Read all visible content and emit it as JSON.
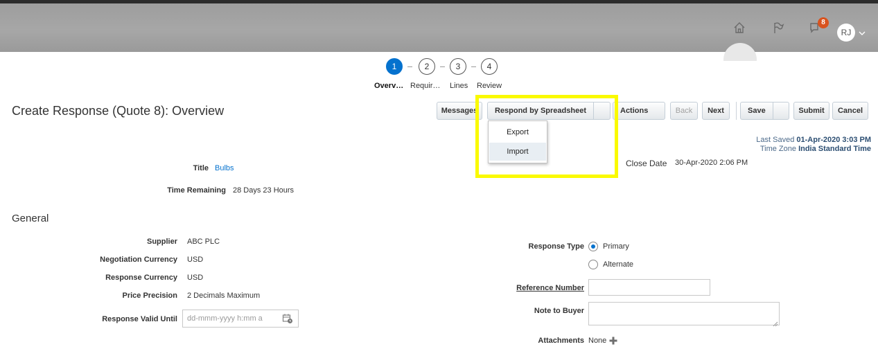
{
  "header": {
    "icons": [
      "home-icon",
      "flag-icon",
      "notifications-icon"
    ],
    "notification_count": "8",
    "user_initials": "RJ"
  },
  "train": {
    "steps": [
      {
        "number": "1",
        "label": "Overv…"
      },
      {
        "number": "2",
        "label": "Requir…"
      },
      {
        "number": "3",
        "label": "Lines"
      },
      {
        "number": "4",
        "label": "Review"
      }
    ],
    "active_step": 1
  },
  "page": {
    "title": "Create Response (Quote 8): Overview"
  },
  "toolbar": {
    "messages": "Messages",
    "respond_by_spreadsheet": "Respond by Spreadsheet",
    "actions": "Actions",
    "back": "Back",
    "next": "Next",
    "save": "Save",
    "submit": "Submit",
    "cancel": "Cancel"
  },
  "spreadsheet_menu": {
    "items": [
      "Export",
      "Import"
    ]
  },
  "saved_info": {
    "last_saved_label": "Last Saved",
    "last_saved_value": "01-Apr-2020 3:03 PM",
    "timezone_label": "Time Zone",
    "timezone_value": "India Standard Time"
  },
  "overview": {
    "title_label": "Title",
    "title_value": "Bulbs",
    "time_remaining_label": "Time Remaining",
    "time_remaining_value": "28 Days 23 Hours",
    "close_date_label": "Close Date",
    "close_date_value": "30-Apr-2020 2:06 PM"
  },
  "general": {
    "heading": "General",
    "supplier_label": "Supplier",
    "supplier_value": "ABC PLC",
    "negotiation_currency_label": "Negotiation Currency",
    "negotiation_currency_value": "USD",
    "response_currency_label": "Response Currency",
    "response_currency_value": "USD",
    "price_precision_label": "Price Precision",
    "price_precision_value": "2 Decimals Maximum",
    "valid_until_label": "Response Valid Until",
    "valid_until_placeholder": "dd-mmm-yyyy h:mm a",
    "response_type_label": "Response Type",
    "response_type_options": [
      "Primary",
      "Alternate"
    ],
    "response_type_selected": "Primary",
    "reference_number_label": "Reference Number",
    "reference_number_value": "",
    "note_to_buyer_label": "Note to Buyer",
    "note_to_buyer_value": "",
    "attachments_label": "Attachments",
    "attachments_value": "None"
  },
  "colors": {
    "accent": "#0572ce",
    "badge": "#d9531e",
    "highlight": "#fafa00",
    "header_bg": "#a3a3a3"
  }
}
